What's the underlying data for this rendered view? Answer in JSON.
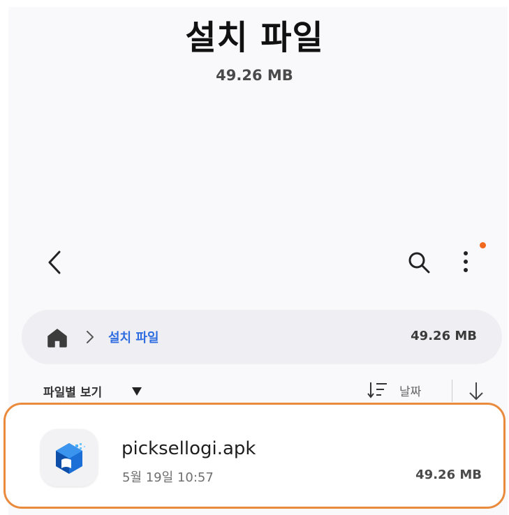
{
  "header": {
    "title": "설치 파일",
    "size": "49.26 MB"
  },
  "toolbar": {
    "back_icon": "chevron-left-icon",
    "search_icon": "search-icon",
    "more_icon": "more-vertical-icon",
    "notification_dot_color": "#f2681d"
  },
  "breadcrumb": {
    "home_icon": "home-icon",
    "separator_icon": "chevron-right-icon",
    "current": "설치 파일",
    "size": "49.26 MB",
    "accent_color": "#2f6de0"
  },
  "filter": {
    "label": "파일별 보기",
    "sort_label": "날짜"
  },
  "files": [
    {
      "name": "picksellogi.apk",
      "date": "5월 19일 10:57",
      "size": "49.26 MB"
    }
  ],
  "highlight_color": "#e98a3c"
}
